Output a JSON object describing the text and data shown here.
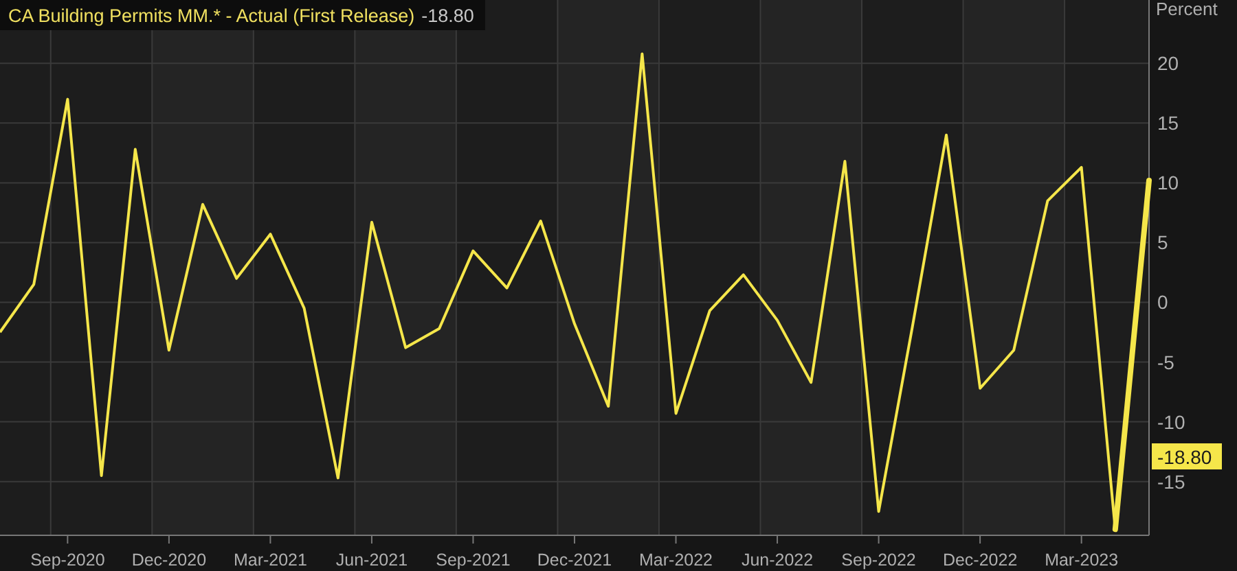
{
  "legend": {
    "value": "-18.80"
  },
  "chart_data": {
    "type": "line",
    "ylabel": "Percent",
    "grid": true,
    "categories": [
      null,
      null,
      "Sep-2020",
      null,
      null,
      "Dec-2020",
      null,
      null,
      "Mar-2021",
      null,
      null,
      "Jun-2021",
      null,
      null,
      "Sep-2021",
      null,
      null,
      "Dec-2021",
      null,
      null,
      "Mar-2022",
      null,
      null,
      "Jun-2022",
      null,
      null,
      "Sep-2022",
      null,
      null,
      "Dec-2022",
      null,
      null,
      "Mar-2023",
      null,
      null
    ],
    "series": [
      {
        "name": "CA Building Permits MM.* - Actual (First Release)",
        "color": "#f5e64a",
        "values": [
          -2.5,
          1.5,
          17,
          -14.5,
          12.8,
          -4,
          8.2,
          2,
          5.7,
          -0.5,
          -14.7,
          6.7,
          -3.8,
          -2.2,
          4.3,
          1.2,
          6.8,
          -1.8,
          -8.7,
          20.8,
          -9.3,
          -0.7,
          2.3,
          -1.5,
          -6.7,
          11.8,
          -17.5,
          -2,
          14,
          -7.2,
          -4,
          8.5,
          11.3,
          -19,
          10.2
        ]
      }
    ],
    "ylim": [
      -19.5,
      25.3
    ],
    "yticks": [
      -15,
      -10,
      -5,
      0,
      5,
      10,
      15,
      20
    ],
    "annotations": [
      {
        "text": "-18.80"
      }
    ]
  }
}
